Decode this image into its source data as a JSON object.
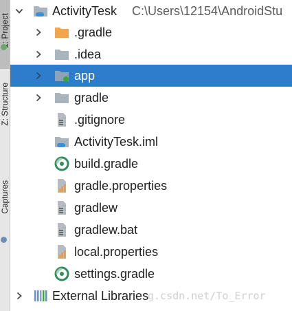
{
  "side_panel": {
    "tabs": [
      {
        "label": "1: Project",
        "icon": "project-icon"
      },
      {
        "label": "Z: Structure",
        "icon": "structure-icon"
      },
      {
        "label": "Captures",
        "icon": "captures-icon"
      }
    ]
  },
  "tree": {
    "root": {
      "name": "ActivityTesk",
      "path": "C:\\Users\\12154\\AndroidStu",
      "expanded": true,
      "icon": "module-folder-icon"
    },
    "children": [
      {
        "name": ".gradle",
        "icon": "folder-icon",
        "expandable": true,
        "selected": false
      },
      {
        "name": ".idea",
        "icon": "folder-icon",
        "expandable": true,
        "selected": false
      },
      {
        "name": "app",
        "icon": "module-folder-icon",
        "expandable": true,
        "selected": true
      },
      {
        "name": "gradle",
        "icon": "folder-icon",
        "expandable": true,
        "selected": false
      },
      {
        "name": ".gitignore",
        "icon": "text-file-icon",
        "expandable": false,
        "selected": false
      },
      {
        "name": "ActivityTesk.iml",
        "icon": "iml-file-icon",
        "expandable": false,
        "selected": false
      },
      {
        "name": "build.gradle",
        "icon": "gradle-file-icon",
        "expandable": false,
        "selected": false
      },
      {
        "name": "gradle.properties",
        "icon": "properties-file-icon",
        "expandable": false,
        "selected": false
      },
      {
        "name": "gradlew",
        "icon": "text-file-icon",
        "expandable": false,
        "selected": false
      },
      {
        "name": "gradlew.bat",
        "icon": "text-file-icon",
        "expandable": false,
        "selected": false
      },
      {
        "name": "local.properties",
        "icon": "properties-file-icon",
        "expandable": false,
        "selected": false
      },
      {
        "name": "settings.gradle",
        "icon": "gradle-file-icon",
        "expandable": false,
        "selected": false
      }
    ],
    "external": {
      "name": "External Libraries",
      "icon": "library-icon",
      "expanded": false
    }
  },
  "watermark": "g.csdn.net/To_Error",
  "colors": {
    "selection": "#2d7dcc",
    "folder": "#a9b4bd",
    "folder_excluded": "#f2a54a",
    "gradle_green": "#2f8f5b",
    "module_dot": "#3aa63a",
    "module_badge": "#3b8fd9",
    "chart_orange": "#f29a3a"
  }
}
